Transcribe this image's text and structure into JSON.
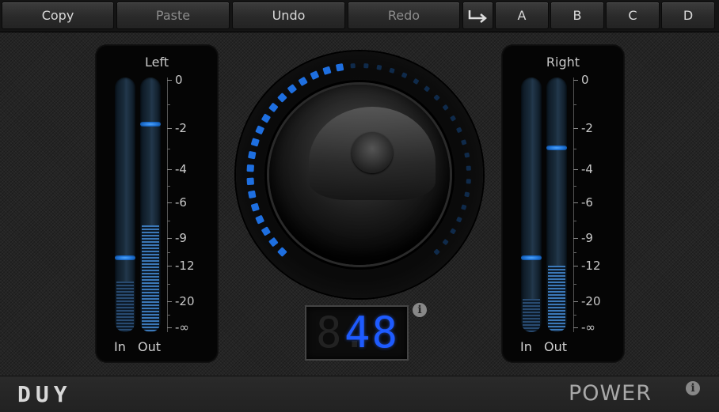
{
  "toolbar": {
    "copy": "Copy",
    "paste": "Paste",
    "undo": "Undo",
    "redo": "Redo",
    "presets": [
      "A",
      "B",
      "C",
      "D"
    ]
  },
  "left_panel": {
    "title": "Left",
    "in_label": "In",
    "out_label": "Out",
    "in_level": 0.2,
    "in_peak": -9,
    "out_level": 0.42,
    "out_peak": -1
  },
  "right_panel": {
    "title": "Right",
    "in_label": "In",
    "out_label": "Out",
    "in_level": 0.13,
    "in_peak": -9,
    "out_level": 0.26,
    "out_peak": -2
  },
  "scale_labels": [
    "0",
    "-2",
    "-4",
    "-6",
    "-9",
    "-12",
    "-20",
    "-∞"
  ],
  "knob": {
    "value_display": "48",
    "ghost_digit": "8.",
    "level": 0.48,
    "accent": "#1e6fe0"
  },
  "footer": {
    "brand": "DUY",
    "product": "POWER"
  },
  "colors": {
    "accent": "#1e6fe0",
    "meter": "#3b78b8"
  }
}
